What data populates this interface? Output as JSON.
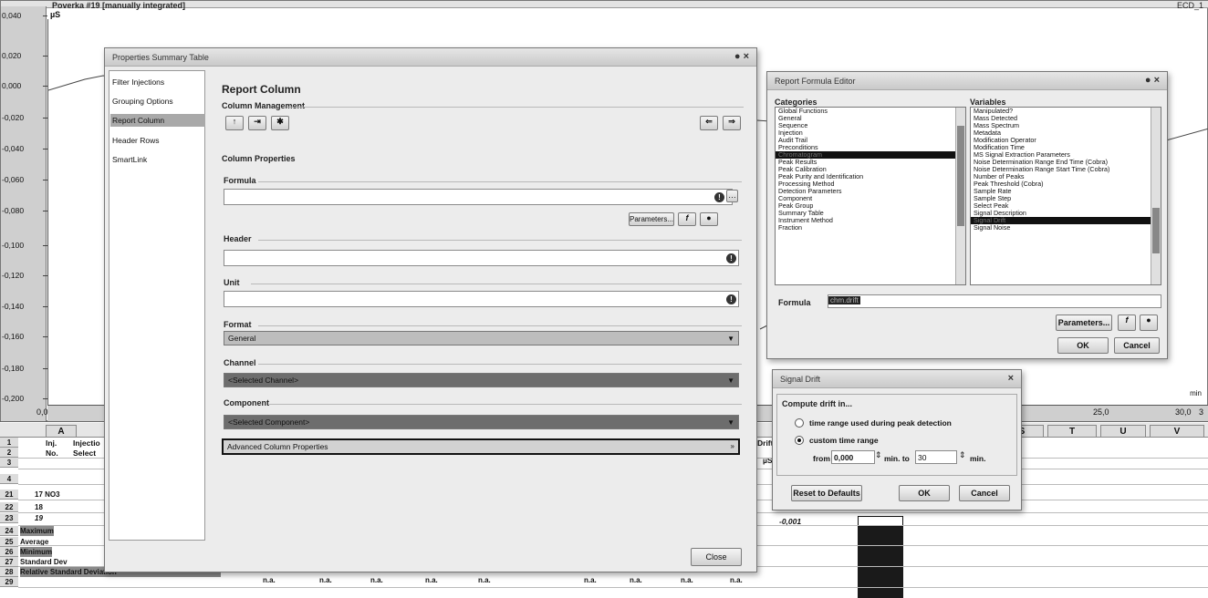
{
  "chromatogram": {
    "title": "Poverka #19 [manually integrated]",
    "right_label": "ECD_1",
    "y_unit": "µS",
    "x_unit": "min",
    "y_ticks": [
      "0,040",
      "0,020",
      "0,000",
      "-0,020",
      "-0,040",
      "-0,060",
      "-0,080",
      "-0,100",
      "-0,120",
      "-0,140",
      "-0,160",
      "-0,180",
      "-0,200"
    ],
    "x_ticks": [
      "0,0",
      "25,0",
      "30,0",
      "3"
    ]
  },
  "sheet": {
    "col_a": "A",
    "col_s": "S",
    "col_t": "T",
    "col_u": "U",
    "col_v": "V",
    "header_inj": "Inj.",
    "header_injectio": "Injectio",
    "header_no": "No.",
    "header_select": "Select",
    "header_drift": "Drift",
    "header_drift_unit": "µS",
    "rows": [
      {
        "num": "1",
        "text": ""
      },
      {
        "num": "2",
        "text": ""
      },
      {
        "num": "3",
        "text": ""
      },
      {
        "num": "4",
        "text": ""
      },
      {
        "num": "21",
        "text": "17  NO3"
      },
      {
        "num": "22",
        "text": "18"
      },
      {
        "num": "23",
        "text": "19"
      },
      {
        "num": "24",
        "text": "Maximum"
      },
      {
        "num": "25",
        "text": "Average"
      },
      {
        "num": "26",
        "text": "Minimum"
      },
      {
        "num": "27",
        "text": "Standard Dev"
      },
      {
        "num": "28",
        "text": "Relative Standard Deviation"
      },
      {
        "num": "29",
        "text": ""
      }
    ],
    "drift_value": "-0,001",
    "na": "n.a."
  },
  "properties": {
    "title": "Properties Summary Table",
    "nav": [
      "Filter Injections",
      "Grouping Options",
      "Report Column",
      "Header Rows",
      "SmartLink"
    ],
    "heading": "Report Column",
    "column_management": "Column Management",
    "column_properties": "Column Properties",
    "formula_label": "Formula",
    "formula_value": "",
    "parameters_btn": "Parameters...",
    "header_label": "Header",
    "header_value": "",
    "unit_label": "Unit",
    "unit_value": "",
    "format_label": "Format",
    "format_value": "General",
    "channel_label": "Channel",
    "channel_value": "<Selected Channel>",
    "component_label": "Component",
    "component_value": "<Selected Component>",
    "advanced": "Advanced Column Properties",
    "close_btn": "Close"
  },
  "formula_editor": {
    "title": "Report Formula Editor",
    "categories_label": "Categories",
    "variables_label": "Variables",
    "categories": [
      "Global Functions",
      "General",
      "Sequence",
      "Injection",
      "Audit Trail",
      "Preconditions",
      "Chromatogram",
      "Peak Results",
      "Peak Calibration",
      "Peak Purity and Identification",
      "Processing Method",
      "Detection Parameters",
      "Component",
      "Peak Group",
      "Summary Table",
      "Instrument Method",
      "Fraction"
    ],
    "variables": [
      "Manipulated?",
      "Mass Detected",
      "Mass Spectrum",
      "Metadata",
      "Modification Operator",
      "Modification Time",
      "MS Signal Extraction Parameters",
      "Noise Determination Range End Time (Cobra)",
      "Noise Determination Range Start Time (Cobra)",
      "Number of Peaks",
      "Peak Threshold (Cobra)",
      "Sample Rate",
      "Sample Step",
      "Select Peak",
      "Signal Description",
      "Signal Drift",
      "Signal Noise"
    ],
    "formula_label": "Formula",
    "formula_value": "chm.drift",
    "parameters_btn": "Parameters...",
    "ok": "OK",
    "cancel": "Cancel"
  },
  "signal_drift": {
    "title": "Signal Drift",
    "group": "Compute drift in...",
    "option1": "time range used during peak detection",
    "option2": "custom time range",
    "from_label": "from",
    "from_value": "0,000",
    "min_to": "min. to",
    "to_value": "30",
    "min": "min.",
    "reset": "Reset to Defaults",
    "ok": "OK",
    "cancel": "Cancel"
  },
  "colors": {
    "dark_bar": "#6d6d6d",
    "selection": "#111111"
  }
}
